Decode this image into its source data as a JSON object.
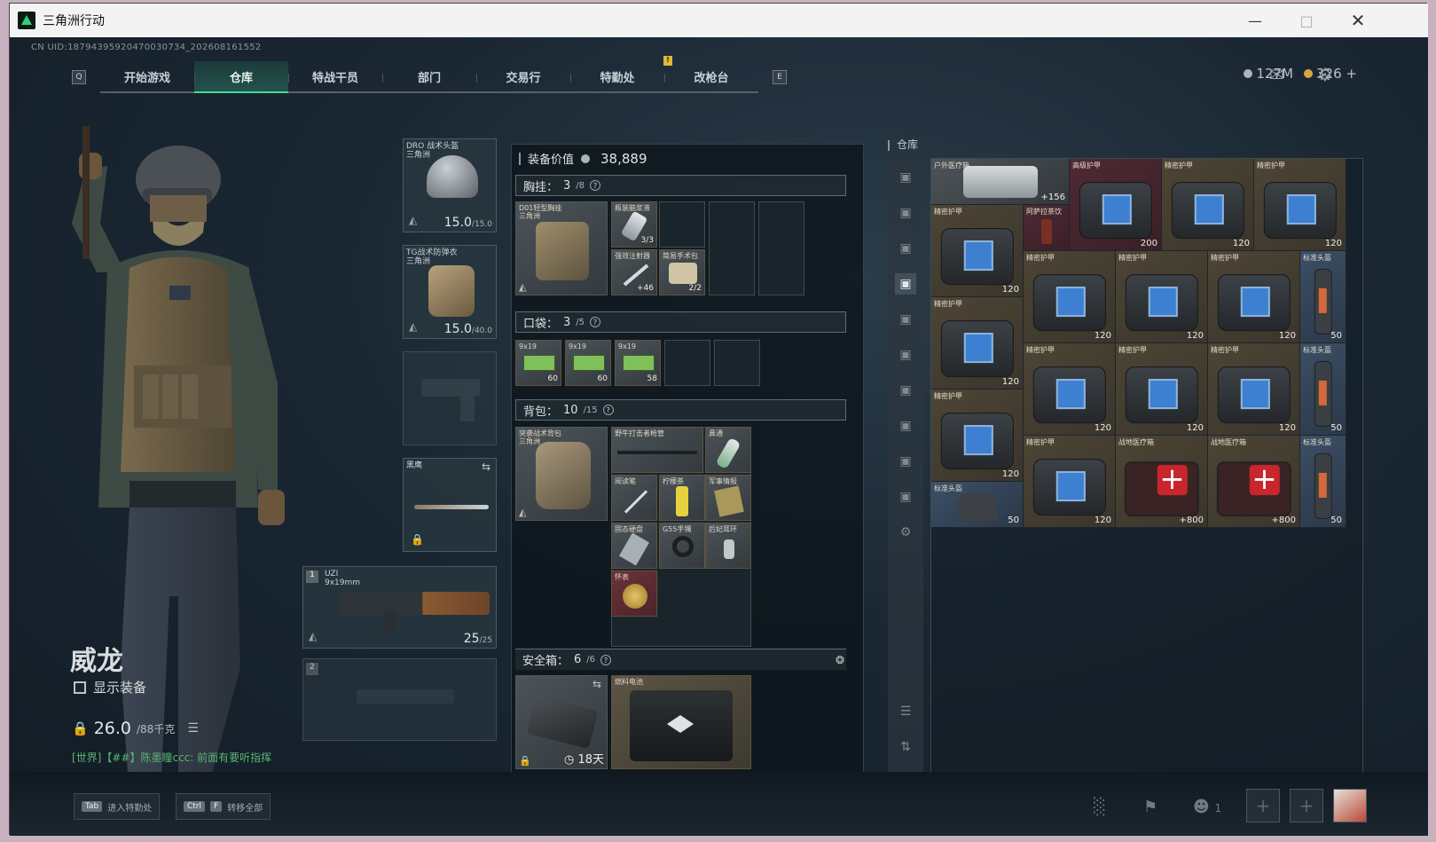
{
  "window": {
    "title": "三角洲行动"
  },
  "header": {
    "uid": "CN UID:1879439592047003073​4_202608161552",
    "tabs": [
      "开始游戏",
      "仓库",
      "特战干员",
      "部门",
      "交易行",
      "特勤处",
      "改枪台"
    ],
    "tab_left_key": "Q",
    "tab_right_key": "E",
    "badge": "!",
    "currency_silver": "127M",
    "currency_gold": "326",
    "currency_add": "+"
  },
  "character": {
    "name": "威龙",
    "show_equipment": "显示装备",
    "weight": "26.0",
    "weight_max": "/88千克",
    "world_chat": "[世界]【##】陈墨瞳ccc: 前面有要听指挥"
  },
  "equipment": {
    "helmet": {
      "name": "DRO 战术头盔",
      "brand": "三角洲",
      "dur": "15.0",
      "max": "/15.0"
    },
    "armor": {
      "name": "TG战术防弹衣",
      "brand": "三角洲",
      "dur": "15.0",
      "max": "/40.0"
    },
    "melee": {
      "name": "黑鹰"
    },
    "primary": {
      "slot": "1",
      "name": "UZI",
      "ammo_type": "9x19mm",
      "ammo": "25",
      "ammo_max": "/25"
    },
    "secondary": {
      "slot": "2"
    }
  },
  "middle": {
    "value_label": "装备价值",
    "value": "38,889",
    "rig": {
      "title": "胸挂：",
      "count": "3",
      "max": "/8",
      "item_name": "D01轻型胸挂",
      "item_brand": "三角洲",
      "items": [
        {
          "name": "瓶装脑浆液",
          "count": "3/3"
        },
        {
          "name": "强效注射器",
          "count": "+46"
        },
        {
          "name": "简易手术包",
          "count": "2/2"
        }
      ]
    },
    "pocket": {
      "title": "口袋：",
      "count": "3",
      "max": "/5",
      "items": [
        {
          "name": "9x19",
          "count": "60"
        },
        {
          "name": "9x19",
          "count": "60"
        },
        {
          "name": "9x19",
          "count": "58"
        }
      ]
    },
    "backpack": {
      "title": "背包：",
      "count": "10",
      "max": "/15",
      "item_name": "突袭战术背包",
      "item_brand": "三角洲",
      "items": [
        {
          "name": "野牛打击者枪管"
        },
        {
          "name": "鼻通"
        },
        {
          "name": "阅读笔"
        },
        {
          "name": "柠檬茶"
        },
        {
          "name": "军事情报"
        },
        {
          "name": "固态硬盘"
        },
        {
          "name": "G55手镯"
        },
        {
          "name": "后妃耳环"
        },
        {
          "name": "怀表"
        }
      ]
    },
    "safebox": {
      "title": "安全箱：",
      "count": "6",
      "max": "/6",
      "days": "18天",
      "item_name": "燃料电池"
    }
  },
  "stash": {
    "title": "仓库",
    "items": [
      {
        "name": "户外医疗箱",
        "count": "+156"
      },
      {
        "name": "高级护甲",
        "count": "200"
      },
      {
        "name": "精密护甲",
        "count": "120"
      },
      {
        "name": "精密护甲",
        "count": "120"
      },
      {
        "name": "精密护甲",
        "count": "120"
      },
      {
        "name": "阿萨拉茶饮",
        "count": ""
      },
      {
        "name": "精密护甲",
        "count": "120"
      },
      {
        "name": "精密护甲",
        "count": "120"
      },
      {
        "name": "精密护甲",
        "count": "120"
      },
      {
        "name": "标准头盔",
        "count": "50"
      },
      {
        "name": "精密护甲",
        "count": "120"
      },
      {
        "name": "精密护甲",
        "count": "120"
      },
      {
        "name": "精密护甲",
        "count": "120"
      },
      {
        "name": "精密护甲",
        "count": "120"
      },
      {
        "name": "标准头盔",
        "count": "50"
      },
      {
        "name": "精密护甲",
        "count": "120"
      },
      {
        "name": "精密护甲",
        "count": "120"
      },
      {
        "name": "战地医疗箱",
        "count": "+800"
      },
      {
        "name": "战地医疗箱",
        "count": "+800"
      },
      {
        "name": "标准头盔",
        "count": "50"
      },
      {
        "name": "标准头盔",
        "count": "50"
      }
    ]
  },
  "bottom": {
    "tab_key": "Tab",
    "tab_label": "进入特勤处",
    "ctrl_key": "Ctrl",
    "f_key": "F",
    "ctrl_label": "转移全部",
    "squad_count": "1"
  },
  "colors": {
    "accent": "#3fe08e",
    "gold": "#e0b832"
  }
}
